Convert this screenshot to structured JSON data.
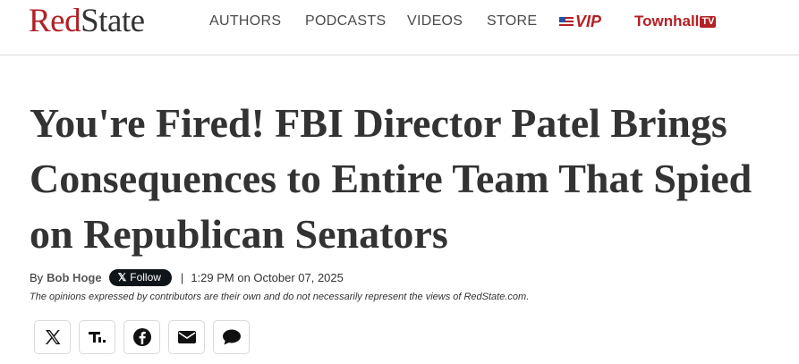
{
  "header": {
    "logo": {
      "part1": "Red",
      "part2": "State"
    },
    "nav": [
      "AUTHORS",
      "PODCASTS",
      "VIDEOS",
      "STORE"
    ],
    "vip_label": "VIP",
    "townhall_label": "Townhall",
    "townhall_badge": "TV"
  },
  "article": {
    "headline": "You're Fired! FBI Director Patel Brings Consequences to Entire Team That Spied on Republican Senators",
    "by_prefix": "By",
    "author": "Bob Hoge",
    "follow_label": "Follow",
    "follow_icon": "x-logo-icon",
    "separator": "|",
    "time": "1:29 PM on October 07, 2025",
    "disclaimer": "The opinions expressed by contributors are their own and do not necessarily represent the views of RedState.com."
  },
  "share": [
    {
      "icon": "x-icon"
    },
    {
      "icon": "truth-social-icon"
    },
    {
      "icon": "facebook-icon"
    },
    {
      "icon": "email-icon"
    },
    {
      "icon": "comment-icon"
    }
  ],
  "colors": {
    "brand_red": "#b32025",
    "text": "#333333",
    "follow_bg": "#0f1419"
  }
}
